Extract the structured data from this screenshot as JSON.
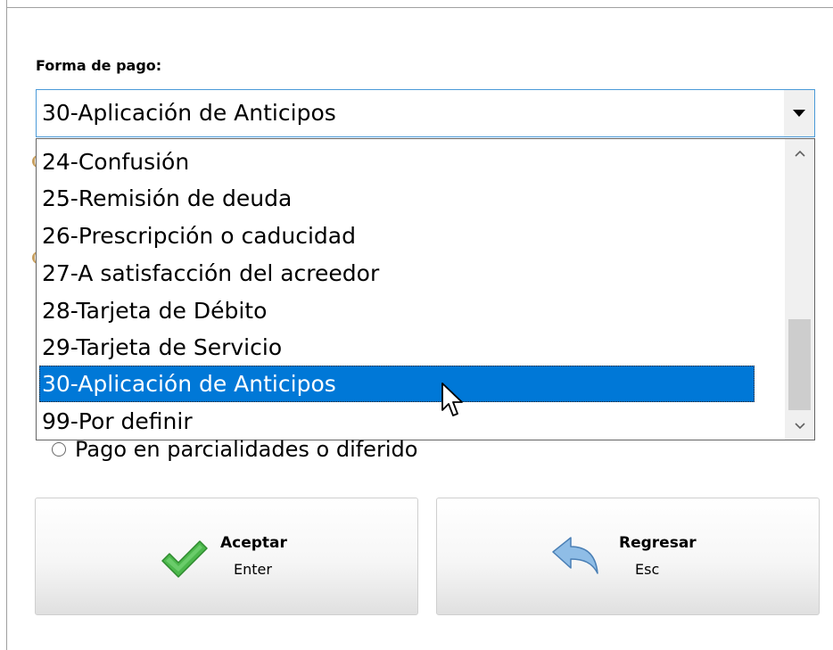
{
  "form": {
    "label": "Forma de pago:",
    "selected_value": "30-Aplicación de Anticipos"
  },
  "dropdown": {
    "items": [
      {
        "label": "24-Confusión",
        "selected": false
      },
      {
        "label": "25-Remisión de deuda",
        "selected": false
      },
      {
        "label": "26-Prescripción o caducidad",
        "selected": false
      },
      {
        "label": "27-A satisfacción del acreedor",
        "selected": false
      },
      {
        "label": "28-Tarjeta de Débito",
        "selected": false
      },
      {
        "label": "29-Tarjeta de Servicio",
        "selected": false
      },
      {
        "label": "30-Aplicación de Anticipos",
        "selected": true
      },
      {
        "label": "99-Por definir",
        "selected": false
      }
    ],
    "scroll_up_icon": "chevron-up-icon",
    "scroll_down_icon": "chevron-down-icon"
  },
  "radio": {
    "label": "Pago en parcialidades o diferido",
    "checked": false
  },
  "buttons": {
    "accept": {
      "title": "Aceptar",
      "shortcut": "Enter",
      "icon": "checkmark-icon"
    },
    "back": {
      "title": "Regresar",
      "shortcut": "Esc",
      "icon": "back-arrow-icon"
    }
  },
  "colors": {
    "selection": "#0078d7",
    "combo_border": "#4a9ad8",
    "check_green": "#4cb84c",
    "arrow_blue": "#7fb0dc"
  }
}
